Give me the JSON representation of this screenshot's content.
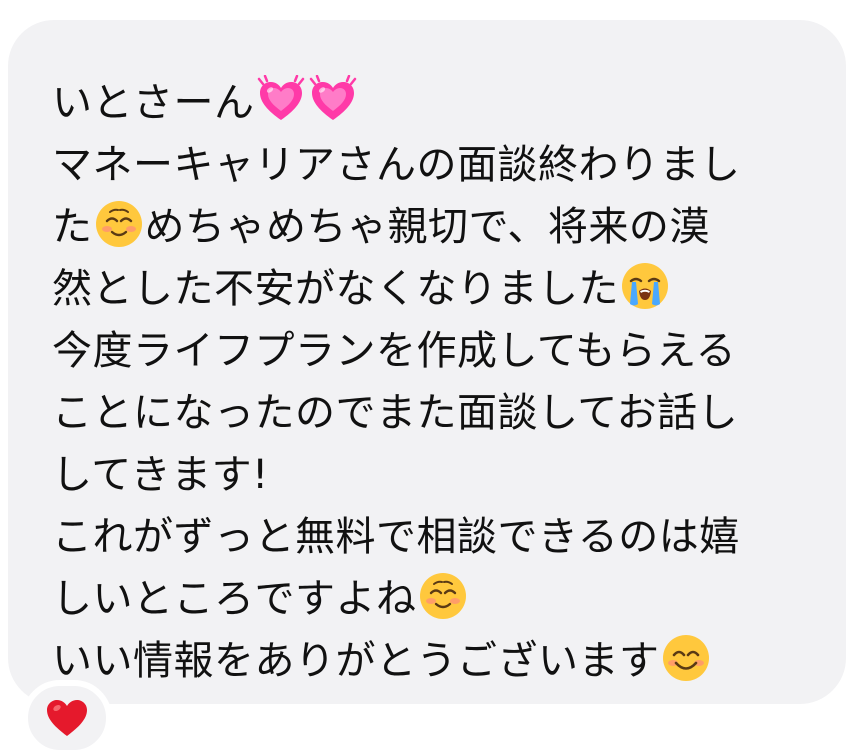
{
  "message": {
    "lines": [
      {
        "segments": [
          {
            "t": "いとさーん"
          },
          {
            "e": "heart"
          },
          {
            "e": "heart"
          }
        ]
      },
      {
        "segments": [
          {
            "t": "マネーキャリアさんの面談終わりまし"
          }
        ]
      },
      {
        "segments": [
          {
            "t": "た"
          },
          {
            "e": "blush"
          },
          {
            "t": "めちゃめちゃ親切で、将来の漠"
          }
        ]
      },
      {
        "segments": [
          {
            "t": "然とした不安がなくなりました"
          },
          {
            "e": "cry"
          }
        ]
      },
      {
        "segments": [
          {
            "t": "今度ライフプランを作成してもらえる"
          }
        ]
      },
      {
        "segments": [
          {
            "t": "ことになったのでまた面談してお話し"
          }
        ]
      },
      {
        "segments": [
          {
            "t": "してきます!"
          }
        ]
      },
      {
        "segments": [
          {
            "t": "これがずっと無料で相談できるのは嬉"
          }
        ]
      },
      {
        "segments": [
          {
            "t": "しいところですよね"
          },
          {
            "e": "blush"
          }
        ]
      },
      {
        "segments": [
          {
            "t": "いい情報をありがとうございます"
          },
          {
            "e": "smile"
          }
        ]
      }
    ]
  },
  "reaction": {
    "icon": "red-heart-icon",
    "color": "#e5192c"
  },
  "colors": {
    "bubble": "#f2f2f4",
    "text": "#111111",
    "heart_pink": "#ff3aa8",
    "emoji_face": "#ffc83d"
  }
}
